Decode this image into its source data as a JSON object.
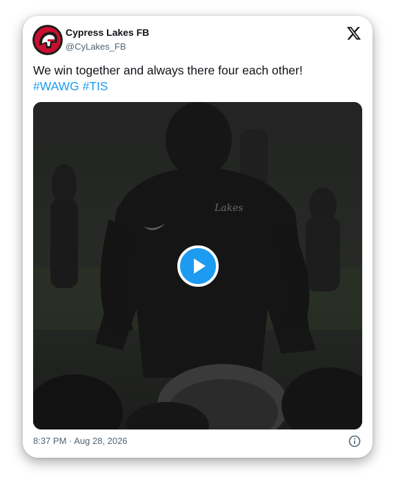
{
  "tweet": {
    "display_name": "Cypress Lakes FB",
    "handle": "@CyLakes_FB",
    "text": "We win together and always there four each other!",
    "hashtags": [
      "#WAWG",
      "#TIS"
    ],
    "timestamp": "8:37 PM · Aug 28, 2026"
  },
  "media": {
    "type": "video",
    "shirt_text": "Lakes"
  },
  "icons": {
    "logo": "x-logo-icon",
    "play": "play-icon",
    "info": "info-icon",
    "avatar": "spartan-helmet-avatar"
  },
  "colors": {
    "accent": "#1d9bf0",
    "text": "#0f1419",
    "secondary_text": "#536471",
    "avatar_red": "#c8102e"
  }
}
